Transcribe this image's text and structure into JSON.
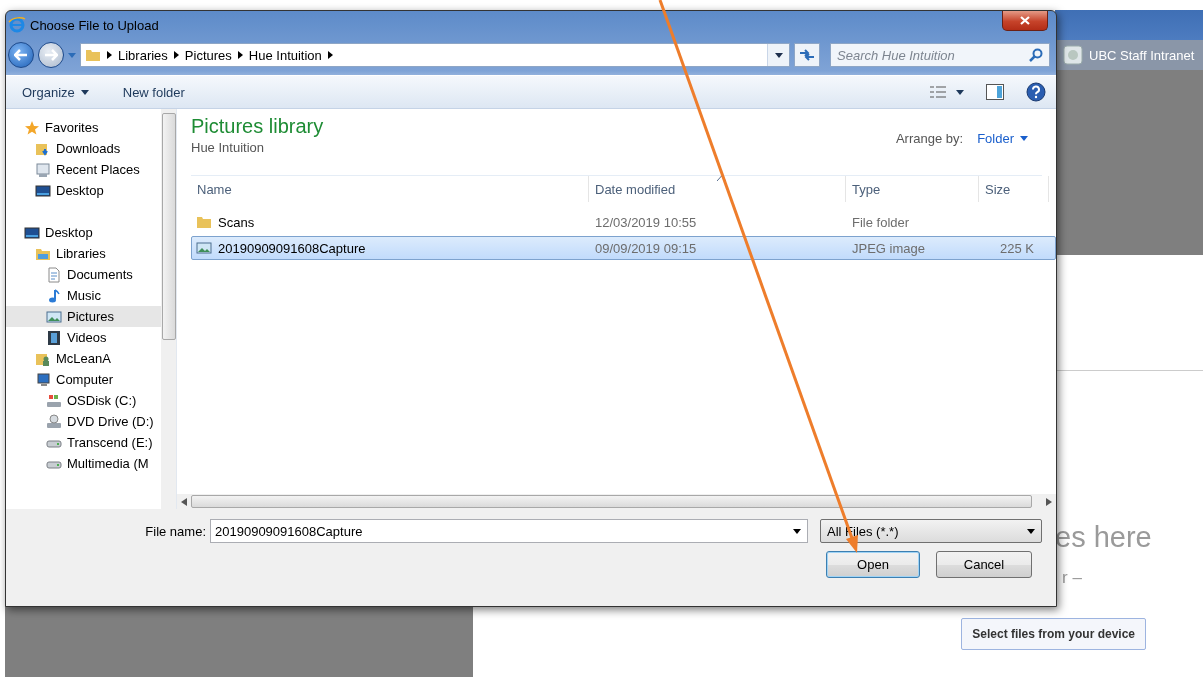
{
  "window": {
    "title": "Choose File to Upload"
  },
  "breadcrumb": [
    "Libraries",
    "Pictures",
    "Hue Intuition"
  ],
  "search": {
    "placeholder": "Search Hue Intuition"
  },
  "toolbar": [
    {
      "label": "Organize",
      "kind": "menu"
    },
    {
      "label": "New folder",
      "kind": "button"
    }
  ],
  "sidebar": {
    "groups": [
      {
        "label": "Favorites",
        "kind": "star",
        "selected": false,
        "children": [
          {
            "label": "Downloads",
            "kind": "downloads",
            "selected": false
          },
          {
            "label": "Recent Places",
            "kind": "recent",
            "selected": false
          },
          {
            "label": "Desktop",
            "kind": "desktop",
            "selected": false
          }
        ]
      },
      {
        "label": "Desktop",
        "kind": "desktop",
        "selected": false,
        "children": [
          {
            "label": "Libraries",
            "kind": "libraries",
            "selected": false,
            "children": [
              {
                "label": "Documents",
                "kind": "document",
                "selected": false
              },
              {
                "label": "Music",
                "kind": "music",
                "selected": false
              },
              {
                "label": "Pictures",
                "kind": "pictures",
                "selected": true
              },
              {
                "label": "Videos",
                "kind": "videos",
                "selected": false
              }
            ]
          },
          {
            "label": "McLeanA",
            "kind": "user",
            "selected": false
          },
          {
            "label": "Computer",
            "kind": "computer",
            "selected": false,
            "children": [
              {
                "label": "OSDisk (C:)",
                "kind": "drive",
                "selected": false
              },
              {
                "label": "DVD Drive (D:)",
                "kind": "dvd",
                "selected": false
              },
              {
                "label": "Transcend (E:)",
                "kind": "usb",
                "selected": false
              },
              {
                "label": "Multimedia (M",
                "kind": "usb",
                "selected": false
              }
            ]
          }
        ]
      }
    ]
  },
  "library": {
    "title": "Pictures library",
    "subtitle": "Hue Intuition",
    "arrange_label": "Arrange by:",
    "arrange_value": "Folder"
  },
  "table": {
    "columns": [
      {
        "label": "Name",
        "sorted": false
      },
      {
        "label": "Date modified",
        "sorted": true
      },
      {
        "label": "Type",
        "sorted": false
      },
      {
        "label": "Size",
        "sorted": false
      }
    ],
    "rows": [
      {
        "kind": "folder",
        "name": "Scans",
        "date": "12/03/2019 10:55",
        "type": "File folder",
        "selected": false
      },
      {
        "kind": "image",
        "name": "20190909091608Capture",
        "date": "09/09/2019 09:15",
        "type": "JPEG image",
        "size": "225 K",
        "selected": true
      }
    ]
  },
  "file_name": {
    "label": "File name:",
    "value": "20190909091608Capture"
  },
  "file_type": {
    "value": "All Files (*.*)"
  },
  "buttons": [
    {
      "label": "Open",
      "default": true
    },
    {
      "label": "Cancel",
      "default": false
    }
  ],
  "background": {
    "tab_title": "UBC Staff Intranet",
    "heading": "es here",
    "subtext": "r –",
    "button": "Select files from your device"
  }
}
